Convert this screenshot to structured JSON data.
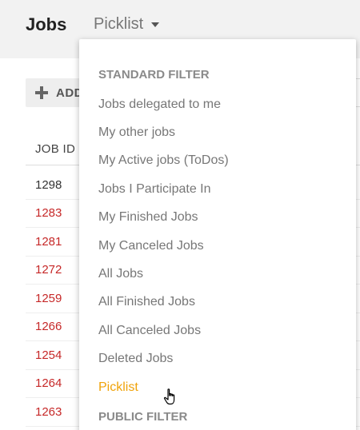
{
  "header": {
    "title": "Jobs",
    "view_selector": "Picklist"
  },
  "toolbar": {
    "add_label": "ADD"
  },
  "table": {
    "column_header": "JOB ID",
    "rows": [
      {
        "id": "1298",
        "link": false
      },
      {
        "id": "1283",
        "link": true
      },
      {
        "id": "1281",
        "link": true
      },
      {
        "id": "1272",
        "link": true
      },
      {
        "id": "1259",
        "link": true
      },
      {
        "id": "1266",
        "link": true
      },
      {
        "id": "1254",
        "link": true
      },
      {
        "id": "1264",
        "link": true
      },
      {
        "id": "1263",
        "link": true
      }
    ]
  },
  "dropdown": {
    "standard_filter_title": "STANDARD FILTER",
    "items": [
      {
        "label": "Jobs delegated to me",
        "active": false
      },
      {
        "label": "My other jobs",
        "active": false
      },
      {
        "label": "My Active jobs (ToDos)",
        "active": false
      },
      {
        "label": "Jobs I Participate In",
        "active": false
      },
      {
        "label": "My Finished Jobs",
        "active": false
      },
      {
        "label": "My Canceled Jobs",
        "active": false
      },
      {
        "label": "All Jobs",
        "active": false
      },
      {
        "label": "All Finished Jobs",
        "active": false
      },
      {
        "label": "All Canceled Jobs",
        "active": false
      },
      {
        "label": "Deleted Jobs",
        "active": false
      },
      {
        "label": "Picklist",
        "active": true
      }
    ],
    "public_filter_title": "PUBLIC FILTER"
  },
  "colors": {
    "link_red": "#c62828",
    "active_orange": "#f0a30a",
    "header_bg": "#f2f2f2"
  },
  "icons": {
    "add": "plus-icon",
    "selector": "caret-down-icon",
    "pointer": "hand-cursor-icon"
  }
}
